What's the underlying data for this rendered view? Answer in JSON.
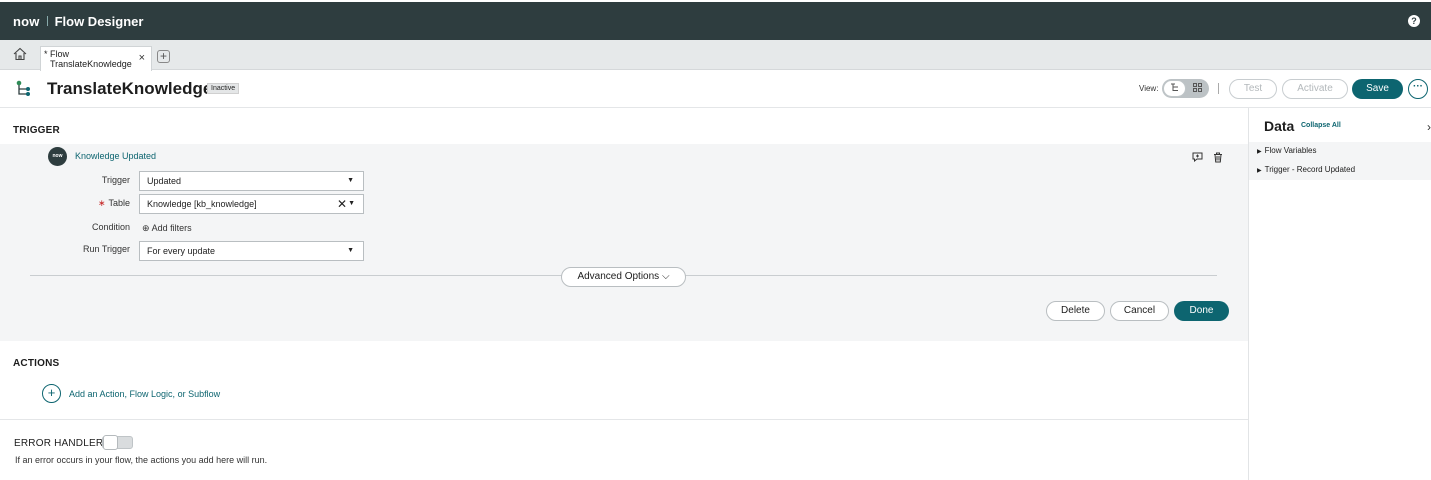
{
  "topbar": {
    "logo": "now",
    "app_title": "Flow Designer",
    "help_icon": "?"
  },
  "tabs": {
    "active": {
      "type_label": "* Flow",
      "name": "TranslateKnowledge"
    },
    "close_glyph": "×",
    "add_glyph": "+"
  },
  "header": {
    "flow_name": "TranslateKnowledge",
    "status": "Inactive",
    "view_label": "View:",
    "test_label": "Test",
    "activate_label": "Activate",
    "save_label": "Save",
    "more_label": "···"
  },
  "trigger": {
    "section_label": "TRIGGER",
    "icon_text": "now",
    "name": "Knowledge Updated",
    "fields": {
      "trigger_label": "Trigger",
      "trigger_value": "Updated",
      "table_label": "Table",
      "table_required": "∗",
      "table_value": "Knowledge [kb_knowledge]",
      "condition_label": "Condition",
      "add_filters": "Add filters",
      "run_trigger_label": "Run Trigger",
      "run_trigger_value": "For every update"
    },
    "advanced_options": "Advanced Options",
    "delete_label": "Delete",
    "cancel_label": "Cancel",
    "done_label": "Done"
  },
  "actions": {
    "section_label": "ACTIONS",
    "add_label": "Add an Action, Flow Logic, or Subflow"
  },
  "error_handler": {
    "label": "ERROR HANDLER",
    "enabled": false,
    "description": "If an error occurs in your flow, the actions you add here will run."
  },
  "data_panel": {
    "title": "Data",
    "collapse_all": "Collapse All",
    "items": [
      {
        "label": "Flow Variables"
      },
      {
        "label": "Trigger - Record Updated"
      }
    ]
  },
  "colors": {
    "topbar": "#2e3d3f",
    "accent": "#0d6570",
    "card_bg": "#f4f5f6"
  }
}
